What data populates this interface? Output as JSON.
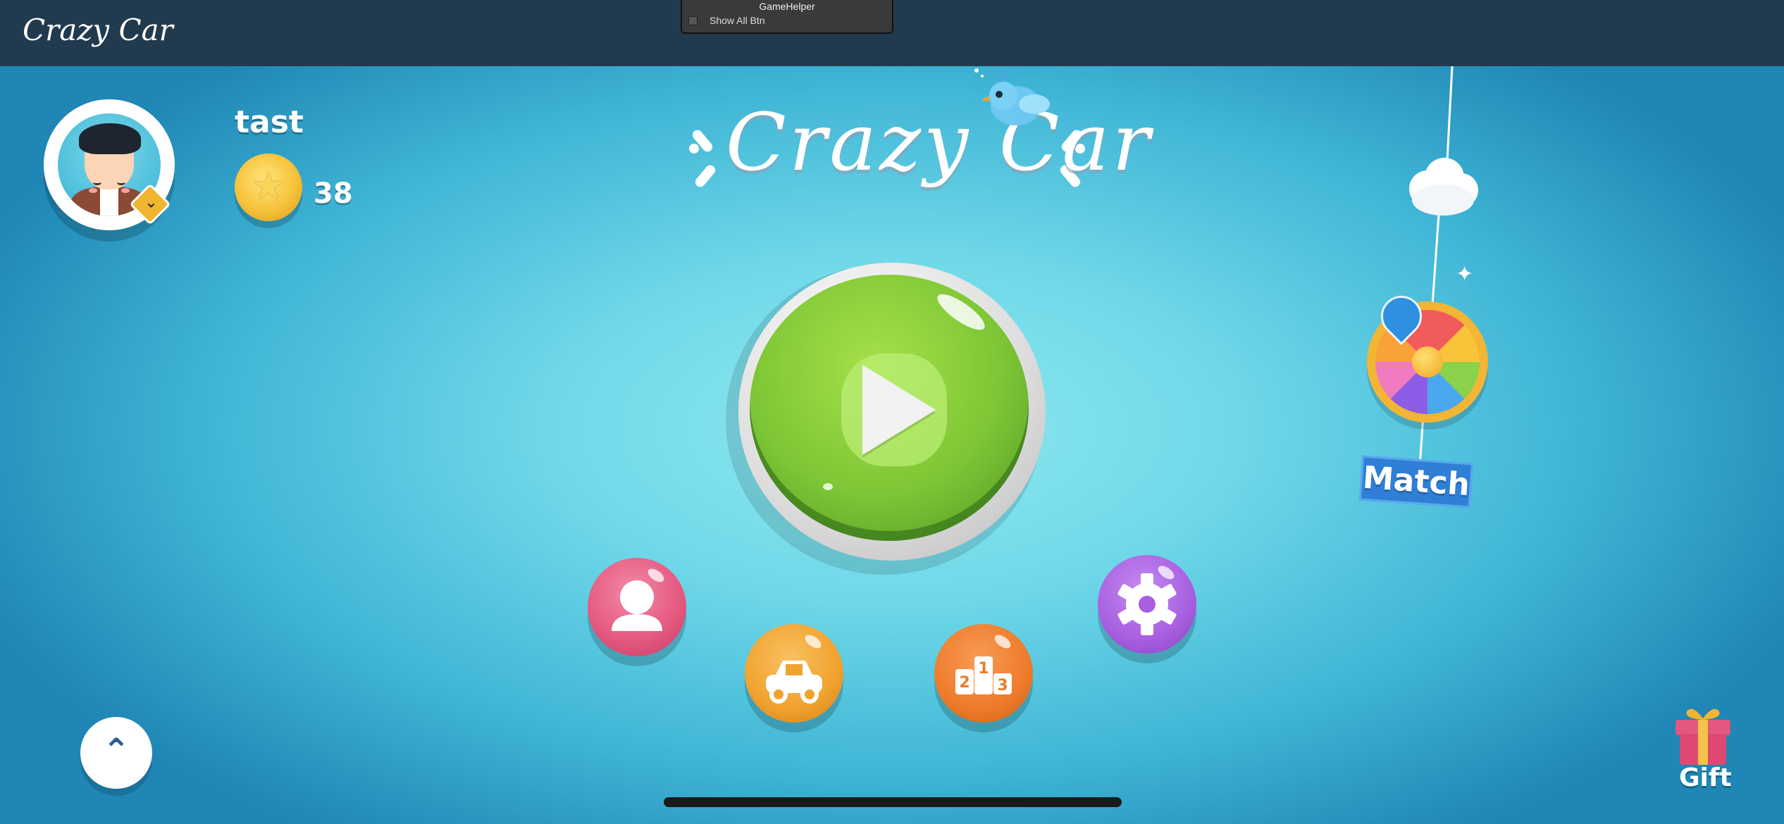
{
  "topbar": {
    "title": "Crazy Car"
  },
  "game_helper": {
    "title": "GameHelper",
    "option_label": "Show All Btn"
  },
  "player": {
    "name": "tast",
    "coins": "38"
  },
  "logo": {
    "text": "Crazy Car"
  },
  "menu": {
    "play": "play-icon",
    "profile": "person-icon",
    "garage": "car-icon",
    "leaderboard": "podium-icon",
    "settings": "gear-icon",
    "podium_labels": [
      "2",
      "1",
      "3"
    ]
  },
  "match": {
    "label": "Match"
  },
  "gift": {
    "label": "Gift"
  },
  "colors": {
    "topbar": "#223a4e",
    "play": "#7dc635",
    "profile": "#e4577f",
    "garage": "#f0a22e",
    "leaderboard": "#ee7b2a",
    "settings": "#a75fe0",
    "match": "#2f7fd6"
  }
}
